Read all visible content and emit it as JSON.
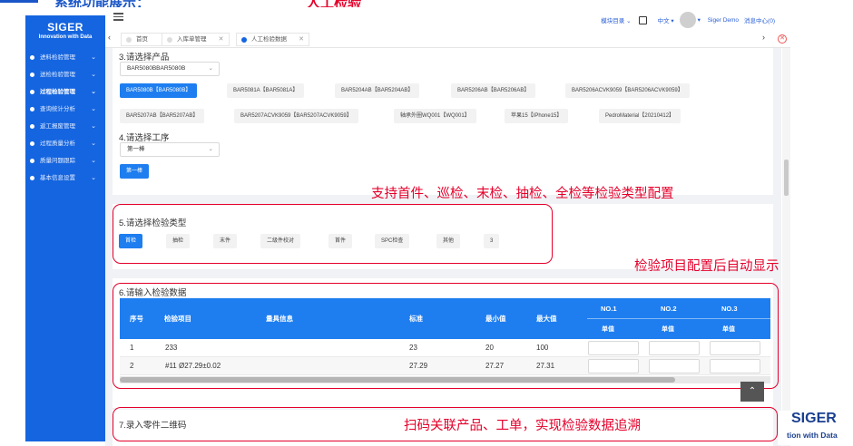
{
  "slide": {
    "title_left": "系统功能展示：",
    "title_right": "人工检验"
  },
  "brand": {
    "name": "SIGER",
    "tagline": "Innovation with Data",
    "corner_name": "SIGER",
    "corner_tagline": "tion with Data"
  },
  "sidebar": {
    "items": [
      {
        "label": "进料检验管理"
      },
      {
        "label": "送检检验管理"
      },
      {
        "label": "过程检验管理"
      },
      {
        "label": "查询统计分析"
      },
      {
        "label": "返工报废管理"
      },
      {
        "label": "过程质量分析"
      },
      {
        "label": "质量问题跟踪"
      },
      {
        "label": "基本信息设置"
      }
    ]
  },
  "header": {
    "module_menu": "模块目录",
    "language": "中文",
    "user": "Siger Demo",
    "messages": "消息中心(0)"
  },
  "tabs": [
    {
      "label": "首页"
    },
    {
      "label": "入库单管理"
    },
    {
      "label": "人工检验数据"
    }
  ],
  "step3": {
    "title": "3.请选择产品",
    "select_value": "BAR5080BBAR5080B",
    "products": [
      "BAR5080B【BAR5080B】",
      "BAR5081A【BAR5081A】",
      "BAR5204AB【BAR5204AB】",
      "BAR5206AB【BAR5206AB】",
      "BAR5206ACVK9059【BAR5206ACVK9059】",
      "BAR5207AB【BAR5207AB】",
      "BAR5207ACVK9059【BAR5207ACVK9059】",
      "轴承外圈WQ001【WQ001】",
      "苹果15【IPhone15】",
      "PedroMaterial【20210412】"
    ]
  },
  "step4": {
    "title": "4.请选择工序",
    "select_value": "第一棒",
    "process_chip": "第一棒"
  },
  "step5": {
    "title": "5.请选择检验类型",
    "types": [
      "首检",
      "抽检",
      "末件",
      "二级件校对",
      "首件",
      "SPC检查",
      "其他",
      "3"
    ]
  },
  "step6": {
    "title": "6.请输入检验数据",
    "columns": {
      "seq": "序号",
      "item": "检验项目",
      "gauge": "量具信息",
      "standard": "标准",
      "min": "最小值",
      "max": "最大值",
      "no1": "NO.1",
      "no2": "NO.2",
      "no3": "NO.3",
      "single": "单值"
    },
    "rows": [
      {
        "seq": "1",
        "item": "233",
        "gauge": "",
        "standard": "23",
        "min": "20",
        "max": "100"
      },
      {
        "seq": "2",
        "item": "#11 Ø27.29±0.02",
        "gauge": "",
        "standard": "27.29",
        "min": "27.27",
        "max": "27.31"
      }
    ]
  },
  "step7": {
    "title": "7.录入零件二维码"
  },
  "annotations": {
    "inspection_types": "支持首件、巡检、末检、抽检、全检等检验类型配置",
    "auto_display": "检验项目配置后自动显示",
    "traceability": "扫码关联产品、工单，实现检验数据追溯"
  },
  "colors": {
    "primary": "#1e7ef0",
    "sidebar": "#1565e0",
    "annotation": "#e4002b"
  }
}
